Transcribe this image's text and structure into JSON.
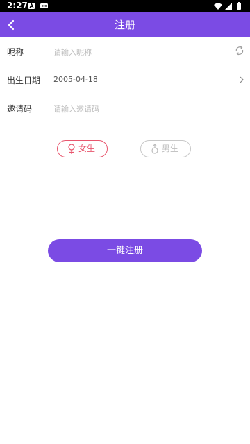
{
  "status_bar": {
    "time": "2:27"
  },
  "app_bar": {
    "title": "注册"
  },
  "form": {
    "nickname": {
      "label": "昵称",
      "placeholder": "请输入昵称"
    },
    "birthday": {
      "label": "出生日期",
      "value": "2005-04-18"
    },
    "invite_code": {
      "label": "邀请码",
      "placeholder": "请输入邀请码"
    }
  },
  "gender": {
    "female_label": "女生",
    "male_label": "男生",
    "selected": "female",
    "female_color": "#e8566e",
    "unselected_color": "#c8c8c8"
  },
  "register_button": {
    "label": "一键注册"
  },
  "colors": {
    "primary": "#7b4be4"
  }
}
